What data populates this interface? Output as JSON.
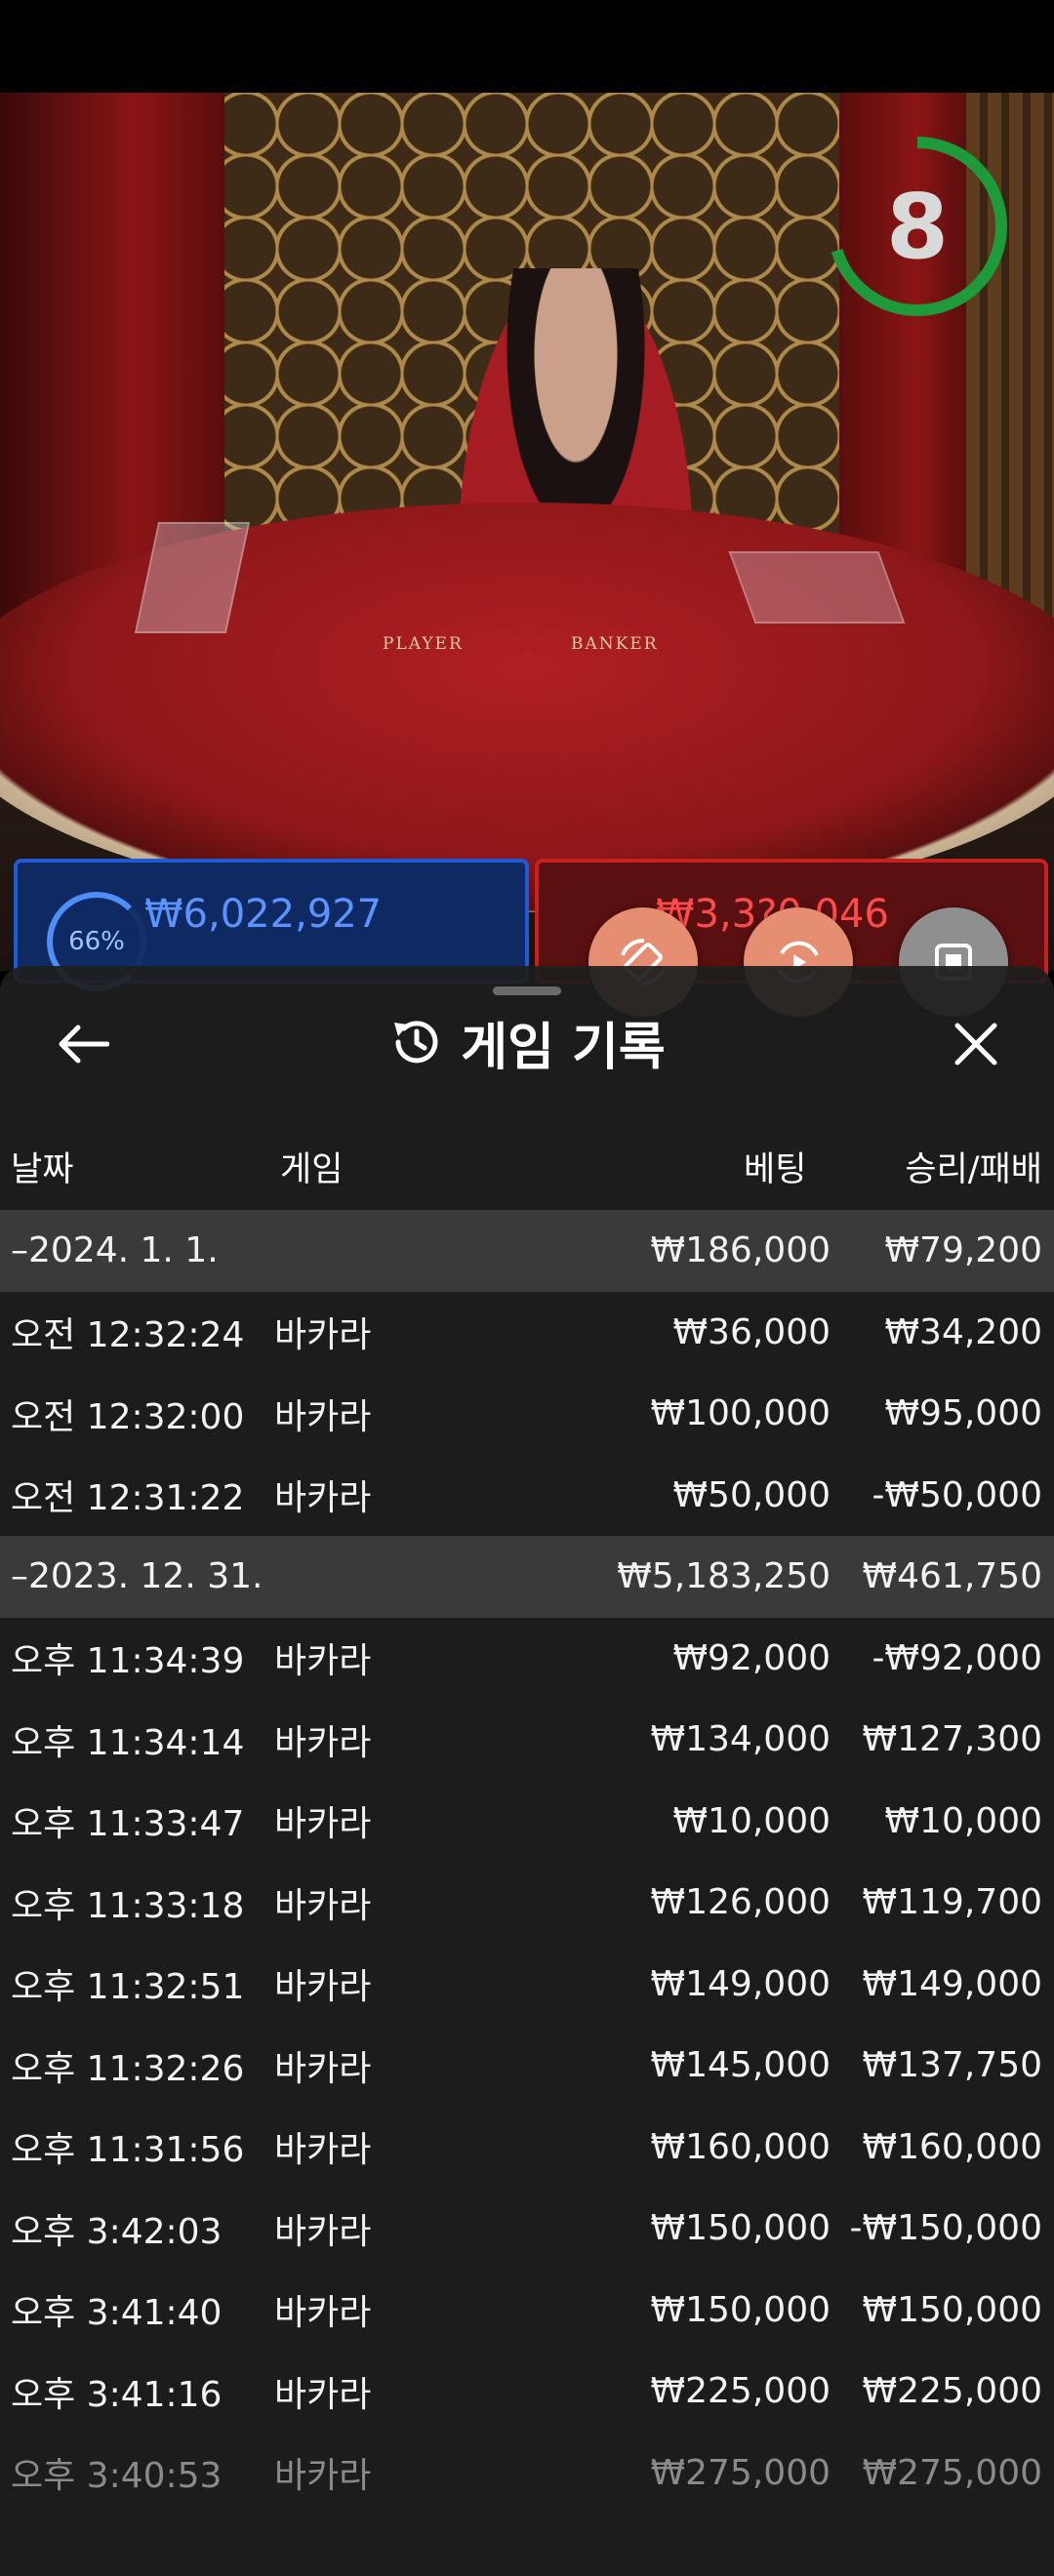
{
  "video": {
    "timer": "8",
    "table_labels": {
      "player": "PLAYER",
      "banker": "BANKER"
    },
    "player_stat": {
      "percent": "66%",
      "amount": "₩6,022,927"
    },
    "banker_stat": {
      "amount": "₩3,3?0,046"
    }
  },
  "colors": {
    "sheet_bg": "#1e1e1e",
    "group_row_bg": "#3a3a3a",
    "fab_orange": "#e58e71",
    "fab_grey": "#8f8f8f",
    "timer_green": "#1f9a3a"
  },
  "fabs": [
    {
      "name": "rotate-screen-icon"
    },
    {
      "name": "replay-icon"
    },
    {
      "name": "stop-icon"
    }
  ],
  "sheet": {
    "title": "게임 기록",
    "title_icon": "history-icon",
    "back_icon": "arrow-left-icon",
    "close_icon": "close-icon",
    "columns": {
      "date": "날짜",
      "game": "게임",
      "bet": "베팅",
      "result": "승리/패배"
    },
    "rows": [
      {
        "type": "group",
        "date": "–2024. 1. 1.",
        "game": "",
        "bet": "₩186,000",
        "result": "₩79,200"
      },
      {
        "type": "item",
        "date": "오전 12:32:24",
        "game": "바카라",
        "bet": "₩36,000",
        "result": "₩34,200"
      },
      {
        "type": "item",
        "date": "오전 12:32:00",
        "game": "바카라",
        "bet": "₩100,000",
        "result": "₩95,000"
      },
      {
        "type": "item",
        "date": "오전 12:31:22",
        "game": "바카라",
        "bet": "₩50,000",
        "result": "-₩50,000"
      },
      {
        "type": "group",
        "date": "–2023. 12. 31.",
        "game": "",
        "bet": "₩5,183,250",
        "result": "₩461,750"
      },
      {
        "type": "item",
        "date": "오후 11:34:39",
        "game": "바카라",
        "bet": "₩92,000",
        "result": "-₩92,000"
      },
      {
        "type": "item",
        "date": "오후 11:34:14",
        "game": "바카라",
        "bet": "₩134,000",
        "result": "₩127,300"
      },
      {
        "type": "item",
        "date": "오후 11:33:47",
        "game": "바카라",
        "bet": "₩10,000",
        "result": "₩10,000"
      },
      {
        "type": "item",
        "date": "오후 11:33:18",
        "game": "바카라",
        "bet": "₩126,000",
        "result": "₩119,700"
      },
      {
        "type": "item",
        "date": "오후 11:32:51",
        "game": "바카라",
        "bet": "₩149,000",
        "result": "₩149,000"
      },
      {
        "type": "item",
        "date": "오후 11:32:26",
        "game": "바카라",
        "bet": "₩145,000",
        "result": "₩137,750"
      },
      {
        "type": "item",
        "date": "오후 11:31:56",
        "game": "바카라",
        "bet": "₩160,000",
        "result": "₩160,000"
      },
      {
        "type": "item",
        "date": "오후 3:42:03",
        "game": "바카라",
        "bet": "₩150,000",
        "result": "-₩150,000"
      },
      {
        "type": "item",
        "date": "오후 3:41:40",
        "game": "바카라",
        "bet": "₩150,000",
        "result": "₩150,000"
      },
      {
        "type": "item",
        "date": "오후 3:41:16",
        "game": "바카라",
        "bet": "₩225,000",
        "result": "₩225,000"
      },
      {
        "type": "item",
        "date": "오후 3:40:53",
        "game": "바카라",
        "bet": "₩275,000",
        "result": "₩275,000"
      }
    ]
  }
}
